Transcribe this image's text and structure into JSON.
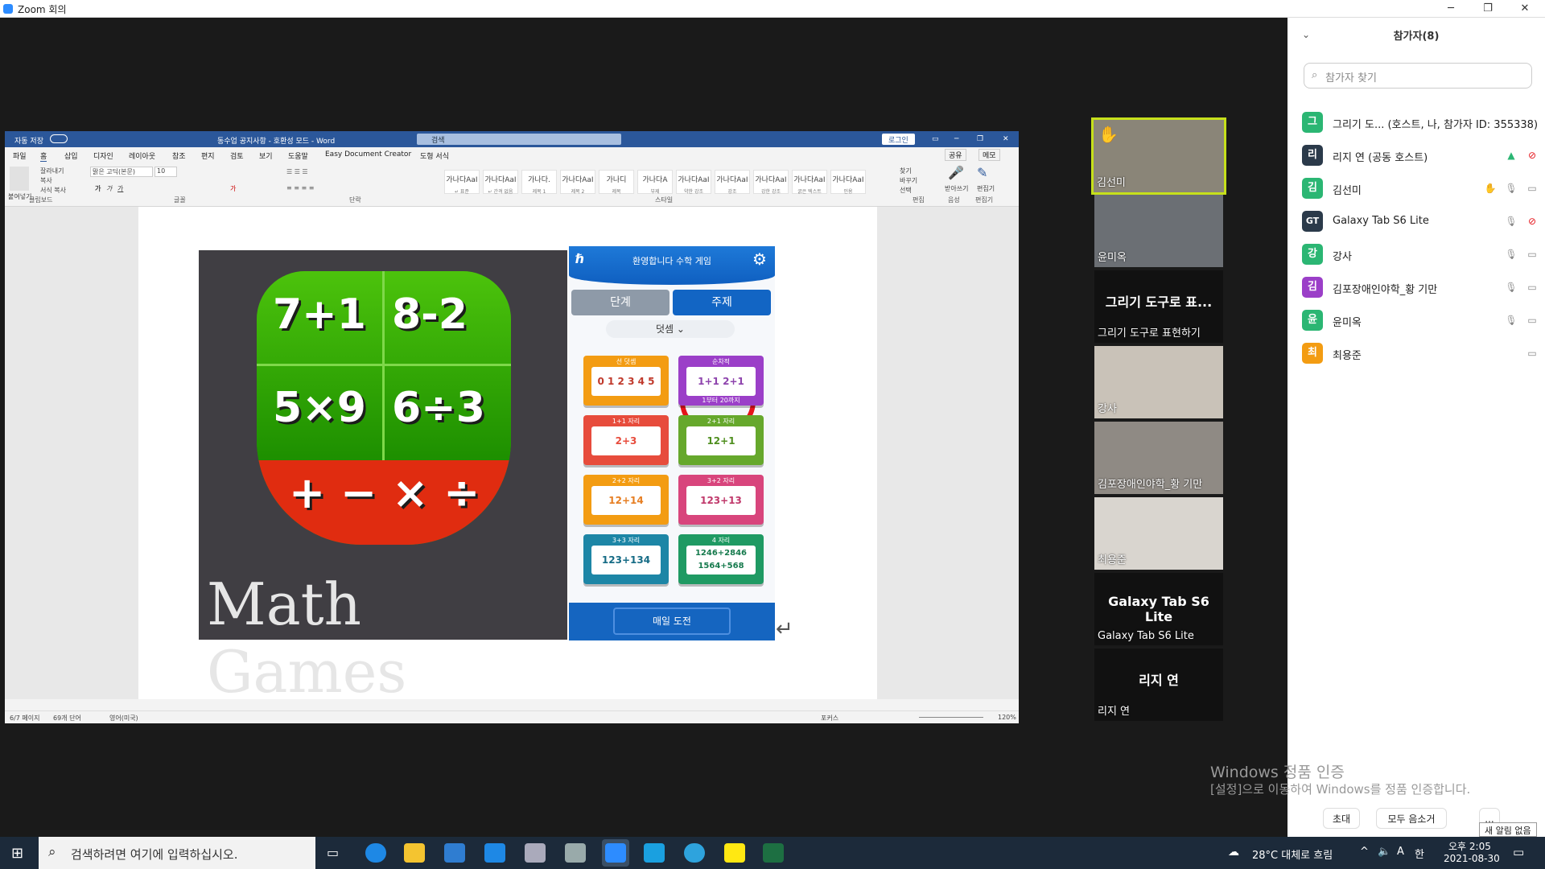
{
  "window": {
    "title": "Zoom 회의"
  },
  "word": {
    "title": "동수업 공지사항 - 호환성 모드 - Word",
    "autosave": "자동 저장",
    "search": "검색",
    "login": "로그인",
    "tabs": [
      "파일",
      "홈",
      "삽입",
      "디자인",
      "레이아웃",
      "참조",
      "편지",
      "검토",
      "보기",
      "도움말",
      "Easy Document Creator",
      "도형 서식"
    ],
    "share": "공유",
    "memo": "메모",
    "clipboard": {
      "paste": "붙여넣기",
      "cut": "잘라내기",
      "copy": "복사",
      "format": "서식 복사",
      "group": "클립보드"
    },
    "font": {
      "name": "맑은 고딕(본문)",
      "size": "10",
      "group": "글꼴"
    },
    "paragraph_group": "단락",
    "styles": [
      {
        "preview": "가나다AaI",
        "name": "↵ 표준"
      },
      {
        "preview": "가나다AaI",
        "name": "↵ 간격 없음"
      },
      {
        "preview": "가나다.",
        "name": "제목 1"
      },
      {
        "preview": "가나다AaI",
        "name": "제목 2"
      },
      {
        "preview": "가나디",
        "name": "제목"
      },
      {
        "preview": "가나다A",
        "name": "부제"
      },
      {
        "preview": "가나다AaI",
        "name": "약한 강조"
      },
      {
        "preview": "가나다AaI",
        "name": "강조"
      },
      {
        "preview": "가나다AaI",
        "name": "강한 강조"
      },
      {
        "preview": "가나다AaI",
        "name": "굵은 텍스트"
      },
      {
        "preview": "가나다AaI",
        "name": "인용"
      }
    ],
    "styles_group": "스타일",
    "edit": {
      "find": "찾기",
      "replace": "바꾸기",
      "select": "선택",
      "group": "편집"
    },
    "voice": {
      "label": "받아쓰기",
      "group": "음성"
    },
    "editor": {
      "label": "편집기",
      "group": "편집기"
    },
    "status": {
      "page": "6/7 페이지",
      "words": "69개 단어",
      "lang": "영어(미국)",
      "focus": "포커스",
      "zoom": "120%"
    }
  },
  "math_image": {
    "equations": [
      "7+1",
      "8-2",
      "5×9",
      "6÷3"
    ],
    "operators": "+ − × ÷",
    "caption": "Math Games"
  },
  "app": {
    "header": "환영합니다 수학 게임",
    "tabs": [
      "단계",
      "주제"
    ],
    "dropdown": "덧셈",
    "cards": [
      {
        "cap": "선 덧셈",
        "body": "0 1 2 3 4 5",
        "color": "#f39c12",
        "text": "#c0392b"
      },
      {
        "cap": "순차적",
        "body": "1+1  2+1",
        "sub": "1부터 20까지",
        "color": "#9b3fc8",
        "text": "#8e44ad"
      },
      {
        "cap": "1+1 자리",
        "body": "2+3",
        "color": "#e74c3c",
        "text": "#e74c3c"
      },
      {
        "cap": "2+1 자리",
        "body": "12+1",
        "color": "#66a82c",
        "text": "#4f8f1f"
      },
      {
        "cap": "2+2 자리",
        "body": "12+14",
        "color": "#f39c12",
        "text": "#e67e22"
      },
      {
        "cap": "3+2 자리",
        "body": "123+13",
        "color": "#d8457c",
        "text": "#c0396b"
      },
      {
        "cap": "3+3 자리",
        "body": "123+134",
        "color": "#1d86a6",
        "text": "#156b85"
      },
      {
        "cap": "4 자리",
        "body": "1246+2846 1564+568",
        "color": "#1f9a63",
        "text": "#167a4d"
      }
    ],
    "footer": "매일 도전"
  },
  "gallery": [
    {
      "name": "김선미",
      "big": "",
      "color": "#8a8578",
      "active": true
    },
    {
      "name": "윤미옥",
      "big": "",
      "color": "#6b6f74",
      "active": false
    },
    {
      "name": "그리기 도구로 표현하기",
      "big": "그리기 도구로 표...",
      "color": "#111111",
      "active": false
    },
    {
      "name": "강사",
      "big": "",
      "color": "#c9c2b8",
      "active": false
    },
    {
      "name": "김포장애인야학_황 기만",
      "big": "",
      "color": "#8f8a84",
      "active": false
    },
    {
      "name": "최용준",
      "big": "",
      "color": "#d9d5cf",
      "active": false
    },
    {
      "name": "Galaxy Tab S6 Lite",
      "big": "Galaxy Tab S6 Lite",
      "color": "#111111",
      "active": false
    },
    {
      "name": "리지 연",
      "big": "리지 연",
      "color": "#111111",
      "active": false
    }
  ],
  "participants_panel": {
    "title": "참가자(8)",
    "search_placeholder": "참가자 찾기",
    "rows": [
      {
        "initial": "그",
        "name": "그리기 도... (호스트, 나, 참가자 ID: 355338)",
        "color": "#2bb673",
        "icons": []
      },
      {
        "initial": "리",
        "name": "리지 연 (공동 호스트)",
        "color": "#2b3a4a",
        "icons": [
          "share-icon",
          "video-off-icon"
        ]
      },
      {
        "initial": "김",
        "name": "김선미",
        "color": "#2bb673",
        "icons": [
          "raised-hand-icon",
          "mic-icon",
          "video-icon"
        ]
      },
      {
        "initial": "GT",
        "name": "Galaxy Tab S6 Lite",
        "color": "#2b3a4a",
        "icons": [
          "mic-icon",
          "video-off-icon"
        ]
      },
      {
        "initial": "강",
        "name": "강사",
        "color": "#2bb673",
        "icons": [
          "mic-icon",
          "video-icon"
        ]
      },
      {
        "initial": "김",
        "name": "김포장애인야학_황 기만",
        "color": "#9b3fc8",
        "icons": [
          "mic-icon",
          "video-icon"
        ]
      },
      {
        "initial": "윤",
        "name": "윤미옥",
        "color": "#2bb673",
        "icons": [
          "mic-icon",
          "video-icon"
        ]
      },
      {
        "initial": "최",
        "name": "최용준",
        "color": "#f39c12",
        "icons": [
          "video-icon"
        ]
      }
    ],
    "invite": "초대",
    "mute_all": "모두 음소거",
    "more": "...",
    "new_notice": "새 알림 없음"
  },
  "activation": {
    "title": "Windows 정품 인증",
    "body": "[설정]으로 이동하여 Windows를 정품 인증합니다."
  },
  "taskbar": {
    "search_placeholder": "검색하려면 여기에 입력하십시오.",
    "weather": "28°C 대체로 흐림",
    "ime": "A",
    "hangul": "한",
    "time": "오후 2:05",
    "date": "2021-08-30"
  }
}
